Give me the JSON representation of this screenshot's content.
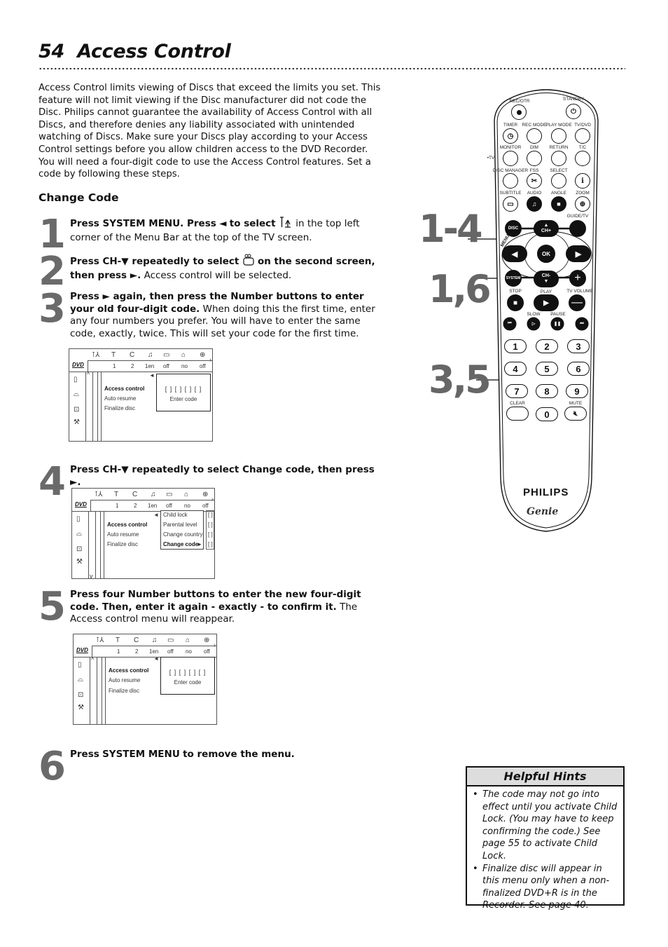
{
  "page": {
    "number": "54",
    "title": "Access Control"
  },
  "intro": {
    "paragraph1": "Access Control limits viewing of Discs that exceed the limits you set. This feature will not limit viewing if the Disc manufacturer did not code the Disc. Philips cannot guarantee the availability of Access Control with all Discs, and therefore denies any liability associated with unintended watching of Discs. Make sure your Discs play according to your Access Control settings before you allow children access to the DVD Recorder.",
    "paragraph2": "You will need a four-digit code to use the Access Control features. Set a code by following these steps."
  },
  "section_heading": "Change Code",
  "steps": [
    {
      "num": "1",
      "bold_a": "Press SYSTEM MENU. Press",
      "bold_b": "to select",
      "normal": "in the top left corner of the Menu Bar at the top of the TV screen."
    },
    {
      "num": "2",
      "bold_a": "Press CH-▼ repeatedly to select",
      "bold_b": "on the second screen, then press ►.",
      "normal": "Access control will be selected."
    },
    {
      "num": "3",
      "bold": "Press ► again, then press the Number buttons to enter your old four-digit code.",
      "normal": "When doing this the first time, enter any four numbers you prefer. You will have to enter the same code, exactly, twice. This will set your code for the first time."
    },
    {
      "num": "4",
      "bold": "Press CH-▼ repeatedly to select Change code, then press ►."
    },
    {
      "num": "5",
      "bold": "Press four Number buttons to enter the new four-digit code. Then, enter it again - exactly - to confirm it.",
      "normal": "The Access control menu will reappear."
    },
    {
      "num": "6",
      "bold_a": "Press",
      "bold_strong": "SYSTEM MENU",
      "bold_b": "to remove the menu."
    }
  ],
  "osd": {
    "logo": "DVD",
    "bar_values": [
      "1",
      "2",
      "1en",
      "off",
      "no",
      "off"
    ],
    "menu_items": [
      "Access control",
      "Auto resume",
      "Finalize disc"
    ],
    "code_placeholder": "[ ] [ ] [ ] [ ]",
    "code_hint": "Enter code",
    "submenu_items": [
      "Child lock",
      "Parental level",
      "Change country",
      "Change code"
    ],
    "check_mark": "[ ]"
  },
  "remote": {
    "labels": {
      "rec_otr": "REC/OTR",
      "standby": "STANDBY",
      "timer": "TIMER",
      "rec_mode": "REC MODE",
      "play_mode": "PLAY MODE",
      "tv_dvd": "TV/DVD",
      "monitor": "MONITOR",
      "dim": "DIM",
      "return": "RETURN",
      "tc": "T/C",
      "tv_side": "•TV",
      "disc_manager": "DISC MANAGER",
      "fss": "FSS",
      "select": "SELECT",
      "subtitle": "SUBTITLE",
      "audio": "AUDIO",
      "angle": "ANGLE",
      "zoom": "ZOOM",
      "guide_tv": "GUIDE/TV",
      "disc": "DISC",
      "ch_plus": "CH+",
      "ok": "OK",
      "system": "SYSTEM",
      "ch_minus": "CH-",
      "menu_arc": "MENU",
      "stop": "STOP",
      "play": "PLAY",
      "tv_volume": "TV VOLUME",
      "slow": "SLOW",
      "pause": "PAUSE",
      "clear": "CLEAR",
      "mute": "MUTE",
      "brand": "PHILIPS",
      "sub_brand": "Genie"
    },
    "digits": [
      "1",
      "2",
      "3",
      "4",
      "5",
      "6",
      "7",
      "8",
      "9",
      "0"
    ],
    "callouts": [
      "1-4",
      "1,6",
      "3,5"
    ]
  },
  "hints": {
    "title": "Helpful Hints",
    "items": [
      "The code may not go into effect until you activate Child Lock. (You may have to keep confirming the code.) See page 55 to activate Child Lock.",
      "Finalize disc will appear in this menu only when a non-finalized DVD+R is in the Recorder. See page 40."
    ]
  }
}
